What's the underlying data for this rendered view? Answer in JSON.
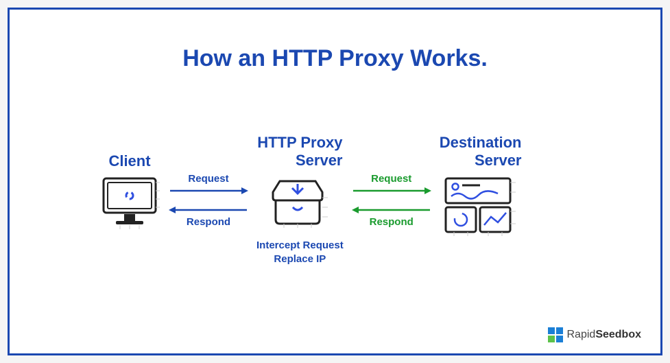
{
  "title": "How an HTTP Proxy Works.",
  "nodes": {
    "client": {
      "label": "Client"
    },
    "proxy": {
      "label_l1": "HTTP Proxy",
      "label_l2": "Server",
      "sub_l1": "Intercept Request",
      "sub_l2": "Replace IP"
    },
    "destination": {
      "label_l1": "Destination",
      "label_l2": "Server"
    }
  },
  "arrows": {
    "left": {
      "top": "Request",
      "bottom": "Respond",
      "color": "blue"
    },
    "right": {
      "top": "Request",
      "bottom": "Respond",
      "color": "green"
    }
  },
  "logo": {
    "brand_light": "Rapid",
    "brand_bold": "Seedbox"
  },
  "colors": {
    "brand_blue": "#1b48b1",
    "accent_green": "#1a9b2e"
  }
}
